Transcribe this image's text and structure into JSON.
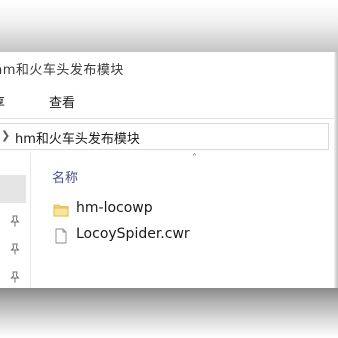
{
  "window": {
    "title": "hm和火车头发布模块"
  },
  "ribbon": {
    "tabs": [
      {
        "label": "享"
      },
      {
        "label": "查看"
      }
    ]
  },
  "address_bar": {
    "path": "hm和火车头发布模块"
  },
  "file_list": {
    "column_header": "名称",
    "items": [
      {
        "name": "hm-locowp",
        "type": "folder"
      },
      {
        "name": "LocoySpider.cwr",
        "type": "file"
      }
    ]
  },
  "colors": {
    "folder_yellow": "#f7d774",
    "selection_gray": "#e5e5e5",
    "header_text": "#4c4c8c"
  },
  "icons": [
    "chevron-right-icon",
    "pin-icon",
    "sort-up-icon",
    "folder-icon",
    "file-icon"
  ]
}
